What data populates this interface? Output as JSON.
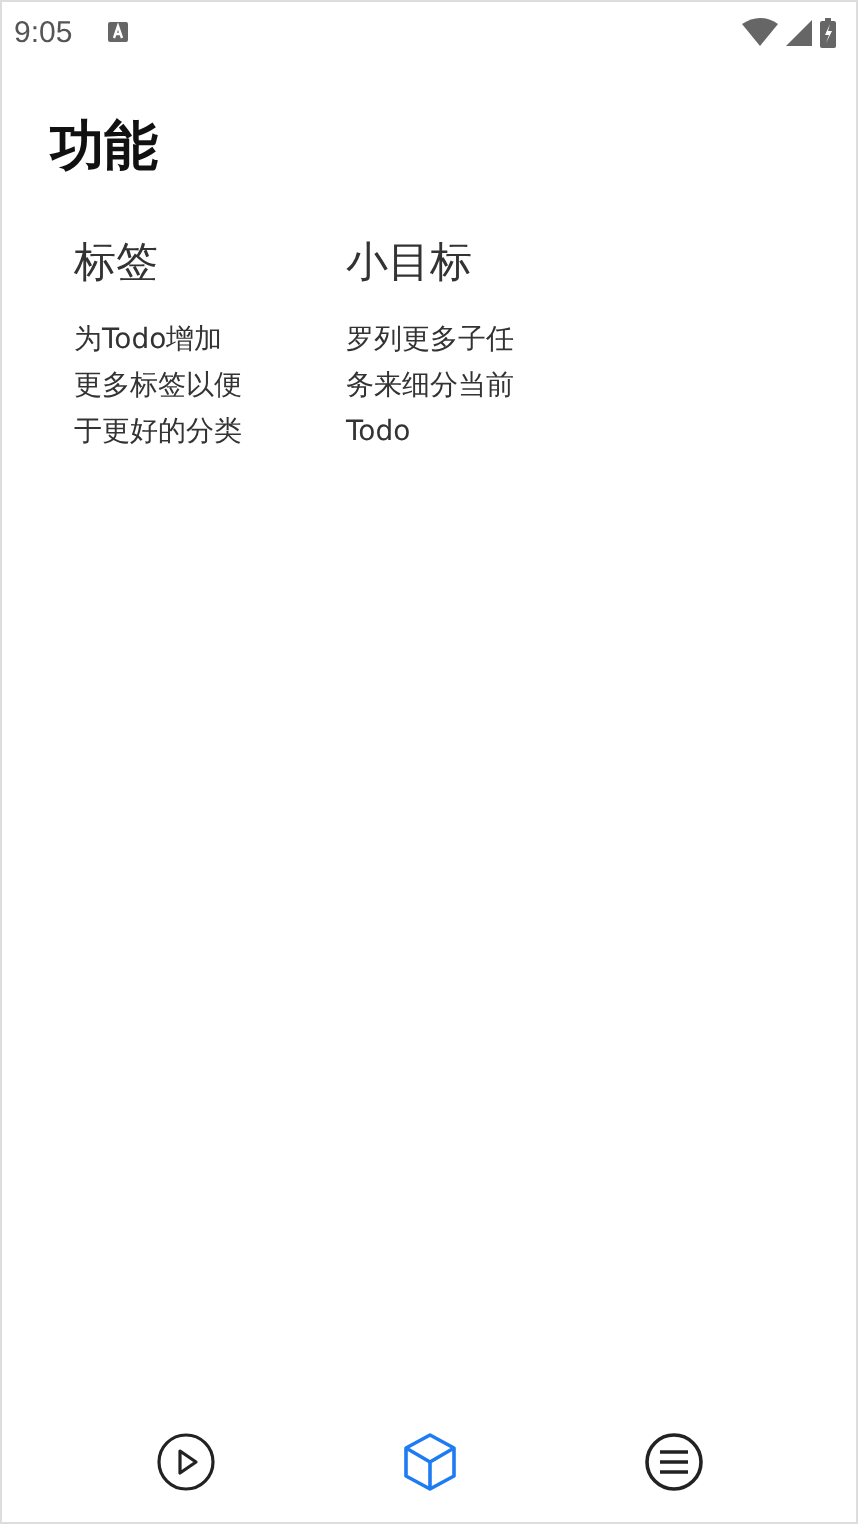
{
  "status_bar": {
    "time": "9:05"
  },
  "page": {
    "title": "功能"
  },
  "features": [
    {
      "title": "标签",
      "description": "为Todo增加更多标签以便于更好的分类"
    },
    {
      "title": "小目标",
      "description": "罗列更多子任务来细分当前Todo"
    }
  ],
  "bottom_nav": [
    {
      "kind": "play",
      "selected": false
    },
    {
      "kind": "cube",
      "selected": true
    },
    {
      "kind": "menu",
      "selected": false
    }
  ]
}
